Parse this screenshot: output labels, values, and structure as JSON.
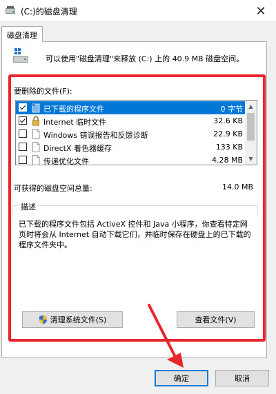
{
  "window": {
    "title": "(C:)的磁盘清理",
    "close_glyph": "✕"
  },
  "tab": {
    "label": "磁盘清理"
  },
  "intro": {
    "text": "可以使用\"磁盘清理\"来释放 (C:) 上的 40.9 MB 磁盘空间。"
  },
  "files": {
    "label": "要删除的文件(F):",
    "items": [
      {
        "name": "已下载的程序文件",
        "size": "0 字节",
        "checked": true,
        "selected": true,
        "icon": "folder-icon"
      },
      {
        "name": "Internet 临时文件",
        "size": "32.6 KB",
        "checked": true,
        "selected": false,
        "icon": "lock-icon"
      },
      {
        "name": "Windows 错误报告和反馈诊断",
        "size": "22.9 KB",
        "checked": false,
        "selected": false,
        "icon": "file-icon"
      },
      {
        "name": "DirectX 着色器缓存",
        "size": "133 KB",
        "checked": false,
        "selected": false,
        "icon": "file-icon"
      },
      {
        "name": "传递优化文件",
        "size": "4.28 MB",
        "checked": false,
        "selected": false,
        "icon": "file-icon"
      }
    ]
  },
  "total": {
    "label": "可获得的磁盘空间总量:",
    "value": "14.0 MB"
  },
  "description": {
    "label": "描述",
    "text": "已下载的程序文件包括 ActiveX 控件和 Java 小程序，你查看特定网页时将会从 Internet 自动下载它们，并临时保存在硬盘上的已下载的程序文件夹中。"
  },
  "buttons": {
    "cleanup": "清理系统文件(S)",
    "view": "查看文件(V)",
    "ok": "确定",
    "cancel": "取消"
  },
  "colors": {
    "selection": "#0078d7",
    "annotation": "#e8262d"
  }
}
